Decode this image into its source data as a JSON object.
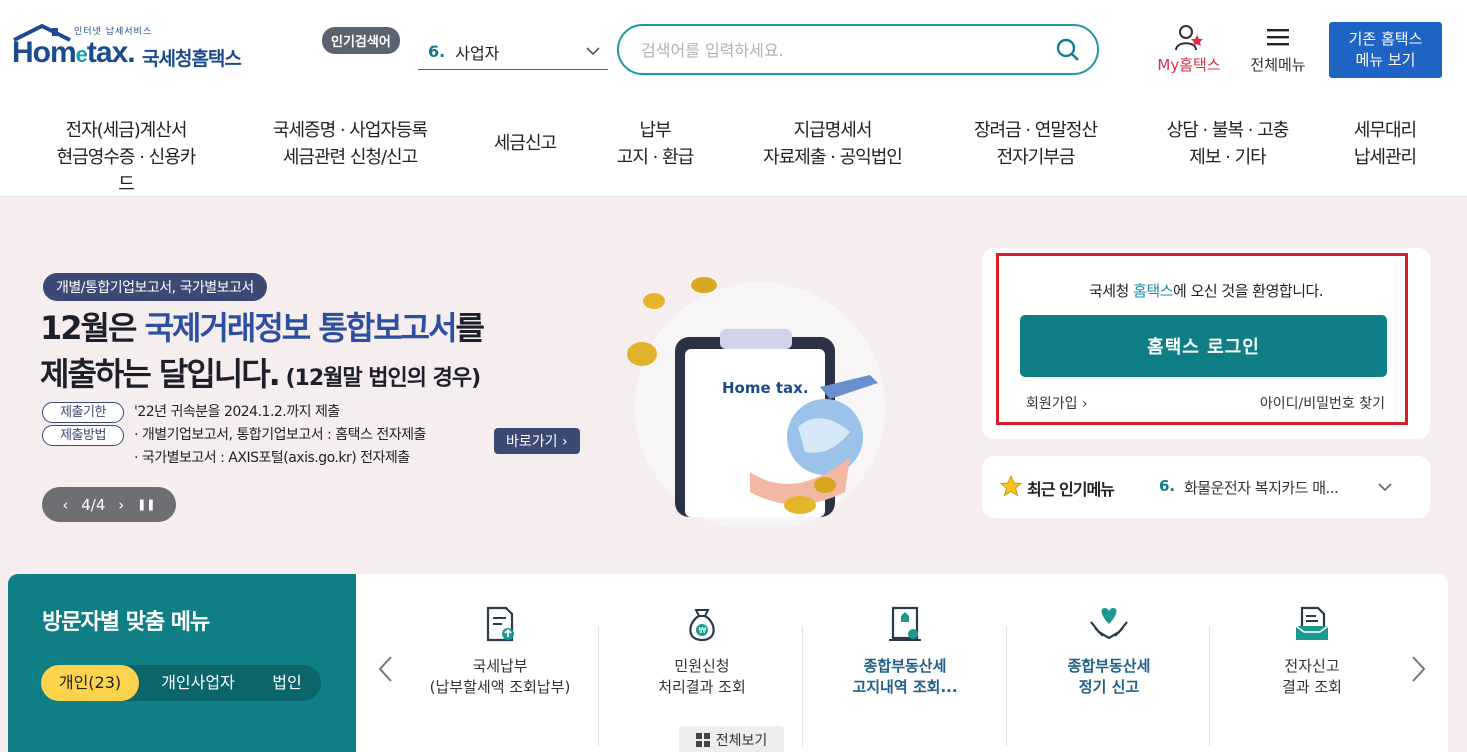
{
  "header": {
    "logo_small": "인터넷 납세서비스",
    "logo_main_a": "Hom",
    "logo_main_e": "e",
    "logo_main_b": "tax.",
    "logo_kor": "국세청홈택스",
    "popular_badge": "인기검색어",
    "popular_num": "6.",
    "popular_value": "사업자",
    "search_placeholder": "검색어를 입력하세요.",
    "my_hometax": "My홈택스",
    "all_menu": "전체메뉴",
    "old_menu_line1": "기존 홈택스",
    "old_menu_line2": "메뉴 보기"
  },
  "gnb": [
    {
      "line1": "전자(세금)계산서",
      "line2": "현금영수증 · 신용카드"
    },
    {
      "line1": "국세증명 · 사업자등록",
      "line2": "세금관련 신청/신고"
    },
    {
      "line1": "세금신고",
      "line2": ""
    },
    {
      "line1": "납부",
      "line2": "고지 · 환급"
    },
    {
      "line1": "지급명세서",
      "line2": "자료제출 · 공익법인"
    },
    {
      "line1": "장려금 · 연말정산",
      "line2": "전자기부금"
    },
    {
      "line1": "상담 · 불복 · 고충",
      "line2": "제보 · 기타"
    },
    {
      "line1": "세무대리",
      "line2": "납세관리"
    }
  ],
  "hero": {
    "tag": "개별/통합기업보고서, 국가별보고서",
    "title_a": "12월은 ",
    "title_hl": "국제거래정보 통합보고서",
    "title_b": "를",
    "title_c": "제출하는 달입니다.",
    "title_sub": " (12월말 법인의 경우)",
    "deadline_label": "제출기한",
    "deadline_text": "'22년 귀속분을 2024.1.2.까지 제출",
    "method_label": "제출방법",
    "method_text1": "· 개별기업보고서, 통합기업보고서 : 홈택스 전자제출",
    "method_text2": "· 국가별보고서 : AXIS포털(axis.go.kr) 전자제출",
    "shortcut": "바로가기 ›",
    "slide_prev": "‹",
    "slide_pos": "4/4",
    "slide_next": "›",
    "slide_pause": "❚❚",
    "visual_logo": "Home tax."
  },
  "login": {
    "welcome_a": "국세청 ",
    "welcome_hl": "홈택스",
    "welcome_b": "에 오신 것을 환영합니다.",
    "login_button": "홈택스 로그인",
    "signup": "회원가입 ›",
    "find_id": "아이디/비밀번호 찾기"
  },
  "recent_menu": {
    "title": "최근 인기메뉴",
    "num": "6.",
    "value": "화물운전자 복지카드 매..."
  },
  "visitor": {
    "title": "방문자별 맞춤 메뉴",
    "tabs": [
      "개인(23)",
      "개인사업자",
      "법인"
    ]
  },
  "quick": {
    "items": [
      {
        "line1": "국세납부",
        "line2": "(납부할세액 조회납부)",
        "icon": "document-upload-icon"
      },
      {
        "line1": "민원신청",
        "line2": "처리결과 조회",
        "icon": "money-bag-icon"
      },
      {
        "line1": "종합부동산세",
        "line2": "고지내역 조회...",
        "icon": "certificate-icon"
      },
      {
        "line1": "종합부동산세",
        "line2": "정기 신고",
        "icon": "heart-hands-icon"
      },
      {
        "line1": "전자신고",
        "line2": "결과 조회",
        "icon": "document-tray-icon"
      }
    ],
    "view_all": "전체보기"
  },
  "colors": {
    "teal": "#107f85",
    "navy": "#3c4975",
    "brand_blue": "#1a4b8c",
    "highlight_red": "#d41f2a",
    "yellow_tab": "#fbd34c"
  }
}
